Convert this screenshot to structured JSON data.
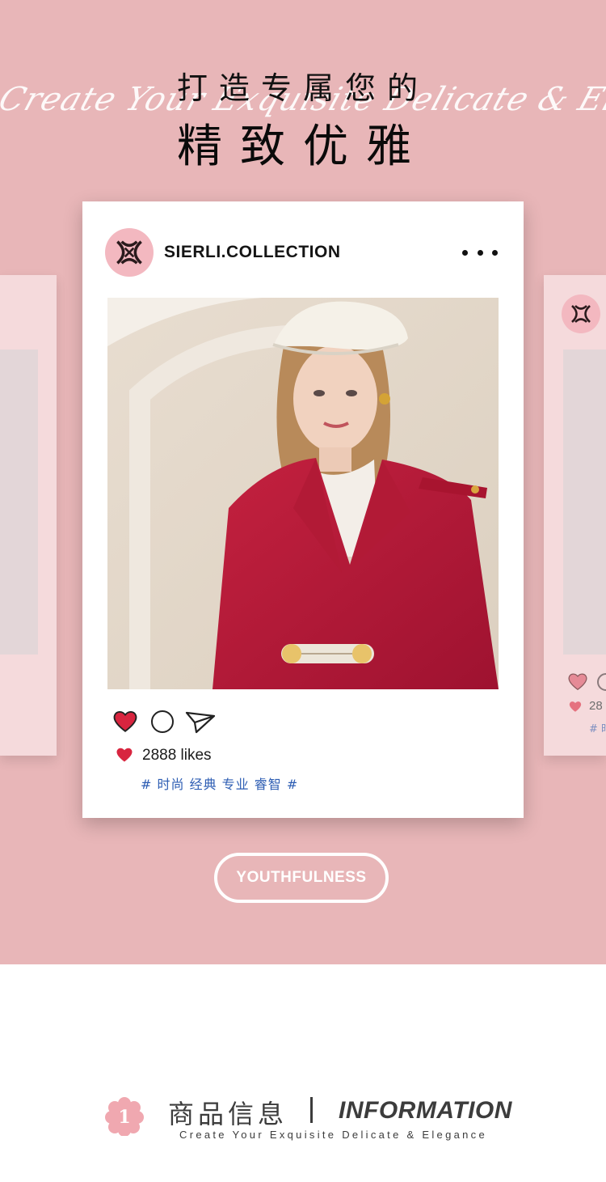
{
  "hero": {
    "title_line1": "打造专属您的",
    "title_line2": "精致优雅",
    "script_text": "Create Your Exquisite Delicate & Elegance"
  },
  "post": {
    "handle": "SIERLI.COLLECTION",
    "likes_text": "2888 likes",
    "hashtags": "# 时尚 经典 专业 睿智 #"
  },
  "side_post": {
    "likes_fragment": "28",
    "tag_fragment": "# 时"
  },
  "pill_label": "YOUTHFULNESS",
  "info": {
    "badge_number": "1",
    "title_cn": "商品信息",
    "title_en": "INFORMATION",
    "subtitle": "Create Your Exquisite Delicate & Elegance"
  },
  "colors": {
    "background_pink": "#e8b6b8",
    "heart_red": "#d8253f",
    "hashtag_blue": "#2d5db3"
  }
}
